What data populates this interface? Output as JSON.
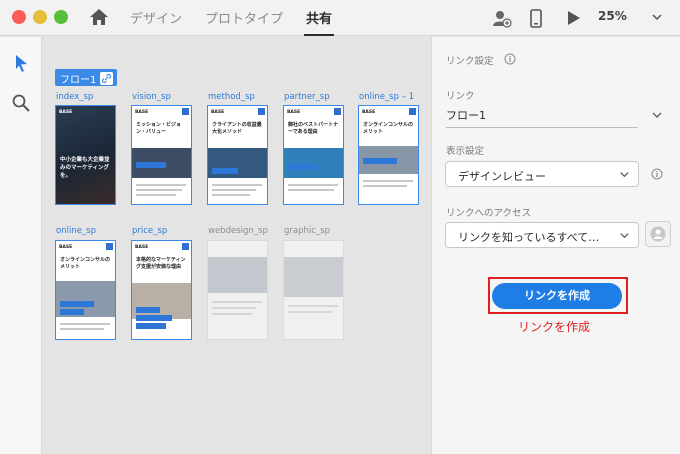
{
  "nav": {
    "tabs": [
      "デザイン",
      "プロトタイプ",
      "共有"
    ],
    "active_tab": "共有",
    "zoom": "25%"
  },
  "canvas": {
    "flow_tag": "フロー1",
    "row1": [
      "index_sp",
      "vision_sp",
      "method_sp",
      "partner_sp",
      "online_sp – 1"
    ],
    "row2": [
      "online_sp",
      "price_sp",
      "webdesign_sp",
      "graphic_sp"
    ],
    "board_texts": {
      "logo": "BASE",
      "vision_title": "ミッション・ビジョン・バリュー",
      "method_title": "クライアントの収益最大化メソッド",
      "partner_title": "御社のベストパートナーである理由",
      "online1_title": "オンラインコンサルのメリット",
      "online_title": "オンラインコンサルのメリット",
      "price_title": "本格的なマーケティング支援が安価な理由",
      "index_hero": "中小企業も大企業並みのマーケティングを。"
    }
  },
  "panel": {
    "link_settings_label": "リンク設定",
    "link_label": "リンク",
    "link_value": "フロー1",
    "display_label": "表示設定",
    "display_value": "デザインレビュー",
    "access_label": "リンクへのアクセス",
    "access_value": "リンクを知っているすべて…",
    "create_button": "リンクを作成",
    "annotation": "リンクを作成"
  },
  "colors": {
    "accent": "#1f7de6",
    "annotation": "#e02020",
    "board_border": "#3b8ae8"
  },
  "icons": [
    "home-icon",
    "add-user-icon",
    "phone-icon",
    "play-icon",
    "chevron-down-icon",
    "select-arrow-icon",
    "search-icon",
    "link-icon",
    "info-icon",
    "user-icon"
  ]
}
